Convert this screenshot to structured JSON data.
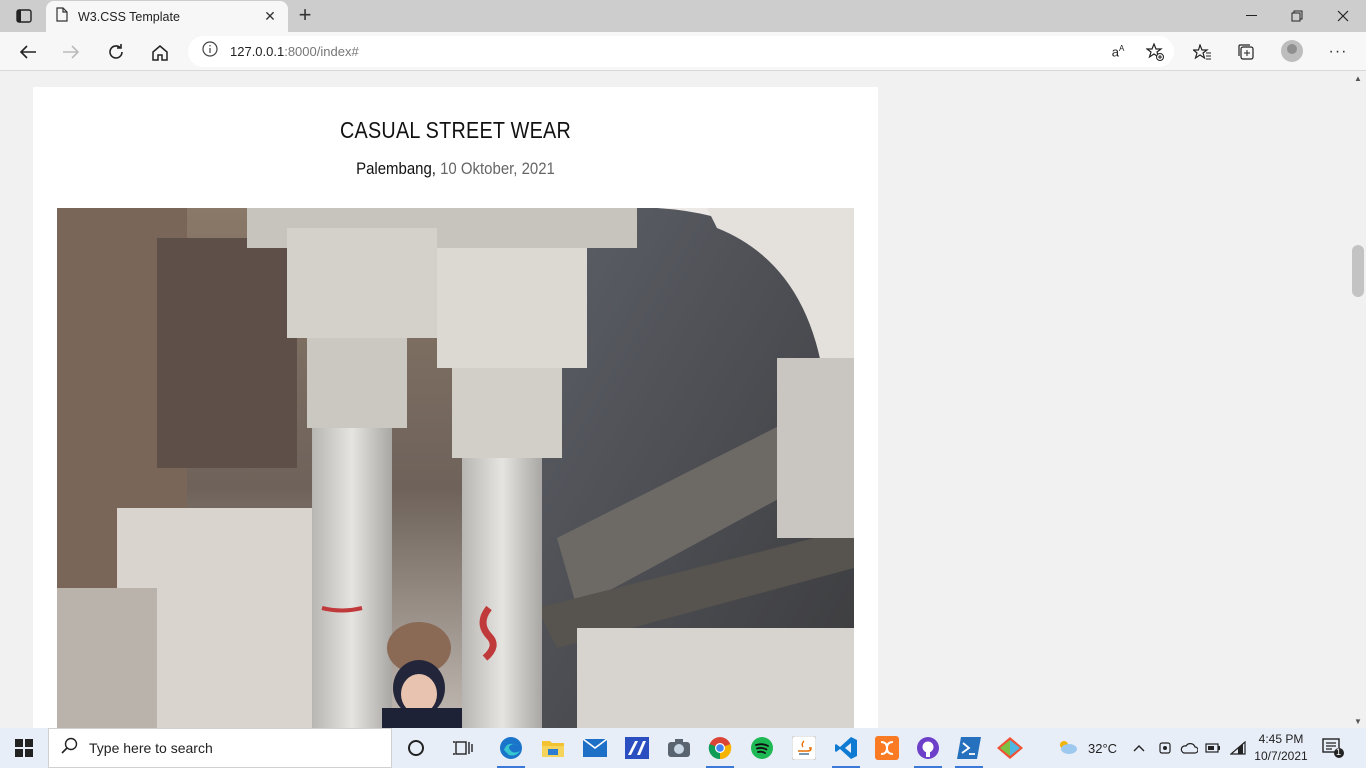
{
  "browser": {
    "tab_title": "W3.CSS Template",
    "url_host": "127.0.0.1",
    "url_rest": ":8000/index#"
  },
  "post": {
    "title": "CASUAL STREET WEAR",
    "location": "Palembang,",
    "date": " 10 Oktober, 2021"
  },
  "taskbar": {
    "search_placeholder": "Type here to search",
    "weather_temp": "32°C",
    "time": "4:45 PM",
    "date": "10/7/2021",
    "notification_count": "1"
  },
  "colors": {
    "page_bg": "#f1f1f1",
    "card_bg": "#ffffff",
    "taskbar_bg": "#e8eef8"
  },
  "icons": [
    "tab-actions-icon",
    "page-icon",
    "close-icon",
    "new-tab-icon",
    "minimize-icon",
    "restore-icon",
    "window-close-icon",
    "back-icon",
    "forward-icon",
    "refresh-icon",
    "home-icon",
    "info-icon",
    "read-aloud-icon",
    "add-favorite-icon",
    "favorites-icon",
    "collections-icon",
    "profile-icon",
    "more-icon",
    "windows-start-icon",
    "search-icon",
    "cortana-icon",
    "task-view-icon",
    "edge-icon",
    "file-explorer-icon",
    "mail-icon",
    "app-icon",
    "camera-icon",
    "chrome-icon",
    "spotify-icon",
    "java-icon",
    "vscode-icon",
    "xampp-icon",
    "github-icon",
    "powershell-icon",
    "git-icon",
    "weather-icon",
    "chevron-up-icon",
    "meet-icon",
    "onedrive-icon",
    "battery-icon",
    "wifi-icon",
    "notification-icon"
  ]
}
